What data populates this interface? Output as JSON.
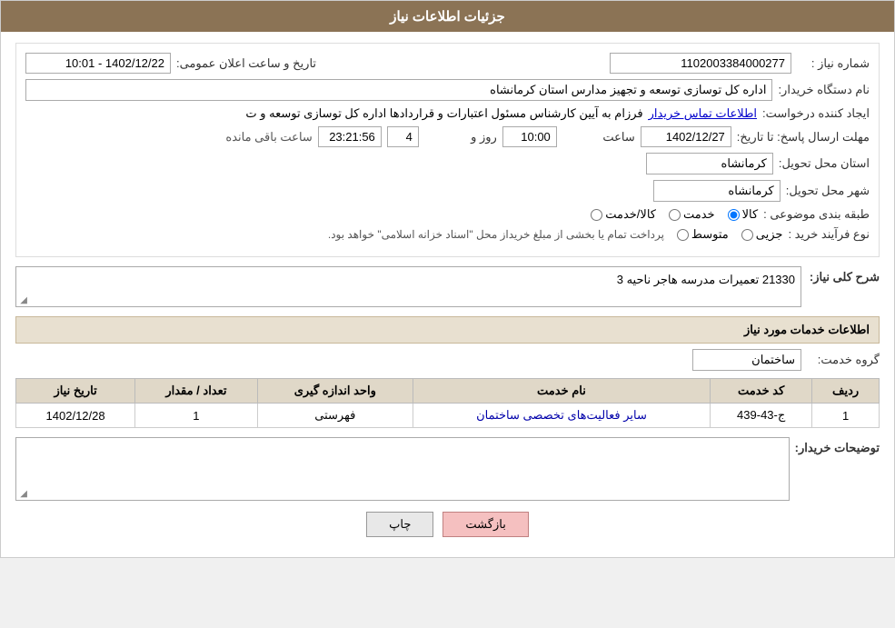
{
  "header": {
    "title": "جزئیات اطلاعات نیاز"
  },
  "fields": {
    "need_number_label": "شماره نیاز :",
    "need_number_value": "1102003384000277",
    "buyer_org_label": "نام دستگاه خریدار:",
    "buyer_org_value": "اداره کل توسازی  توسعه و تجهیز مدارس استان کرمانشاه",
    "announcement_label": "تاریخ و ساعت اعلان عمومی:",
    "announcement_value": "1402/12/22 - 10:01",
    "creator_label": "ایجاد کننده درخواست:",
    "creator_value": "فرزام به آیین کارشناس مسئول اعتبارات و قراردادها اداره کل توسازی  توسعه و ت",
    "creator_link": "اطلاعات تماس خریدار",
    "deadline_label": "مهلت ارسال پاسخ: تا تاریخ:",
    "deadline_date": "1402/12/27",
    "deadline_time": "10:00",
    "deadline_days": "4",
    "deadline_clock": "23:21:56",
    "deadline_remaining": "ساعت باقی مانده",
    "deadline_and": "روز و",
    "province_label": "استان محل تحویل:",
    "province_value": "کرمانشاه",
    "city_label": "شهر محل تحویل:",
    "city_value": "کرمانشاه",
    "category_label": "طبقه بندی موضوعی :",
    "category_options": [
      "کالا",
      "خدمت",
      "کالا/خدمت"
    ],
    "category_selected": "کالا",
    "process_label": "نوع فرآیند خرید :",
    "process_options": [
      "جزیی",
      "متوسط"
    ],
    "process_note": "پرداخت تمام یا بخشی از مبلغ خریداز محل \"اسناد خزانه اسلامی\" خواهد بود.",
    "need_desc_label": "شرح کلی نیاز:",
    "need_desc_value": "21330 تعمیرات مدرسه هاجر ناحیه 3",
    "services_title": "اطلاعات خدمات مورد نیاز",
    "service_group_label": "گروه خدمت:",
    "service_group_value": "ساختمان",
    "table": {
      "headers": [
        "ردیف",
        "کد خدمت",
        "نام خدمت",
        "واحد اندازه گیری",
        "تعداد / مقدار",
        "تاریخ نیاز"
      ],
      "rows": [
        {
          "row_num": "1",
          "service_code": "ج-43-439",
          "service_name": "سایر فعالیت‌های تخصصی ساختمان",
          "unit": "فهرستی",
          "quantity": "1",
          "date": "1402/12/28"
        }
      ]
    },
    "buyer_notes_label": "توضیحات خریدار:",
    "buyer_notes_value": ""
  },
  "buttons": {
    "print": "چاپ",
    "back": "بازگشت"
  }
}
